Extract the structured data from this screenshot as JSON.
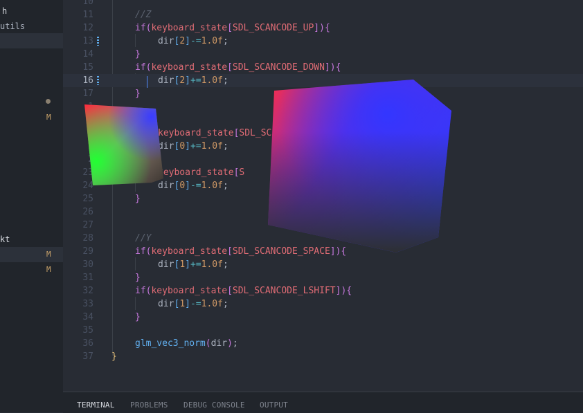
{
  "sidebar": {
    "rows": [
      {
        "text": "h",
        "badge": ""
      },
      {
        "text": "utils",
        "badge": ""
      },
      {
        "text": "kt",
        "badge": ""
      }
    ],
    "badges": [
      "M",
      "M",
      "M"
    ]
  },
  "editor": {
    "lines": [
      {
        "n": "10"
      },
      {
        "n": "11"
      },
      {
        "n": "12"
      },
      {
        "n": "13"
      },
      {
        "n": "14"
      },
      {
        "n": "15"
      },
      {
        "n": "16"
      },
      {
        "n": "17"
      },
      {
        "n": "1"
      },
      {
        "n": "2"
      },
      {
        "n": "2"
      },
      {
        "n": "2"
      },
      {
        "n": "23"
      },
      {
        "n": "24"
      },
      {
        "n": "25"
      },
      {
        "n": "26"
      },
      {
        "n": "27"
      },
      {
        "n": "28"
      },
      {
        "n": "29"
      },
      {
        "n": "30"
      },
      {
        "n": "31"
      },
      {
        "n": "32"
      },
      {
        "n": "33"
      },
      {
        "n": "34"
      },
      {
        "n": "35"
      },
      {
        "n": "36"
      },
      {
        "n": "37"
      }
    ],
    "current_line": "16"
  },
  "code": {
    "c_z": "//Z",
    "c_y": "//Y",
    "kw_if": "if",
    "ks": "keyboard_state",
    "dir": "dir",
    "up": "SDL_SCANCODE_UP",
    "down": "SDL_SCANCODE_DOWN",
    "sc": "SDL_SC",
    "s": "S",
    "space": "SDL_SCANCODE_SPACE",
    "lshift": "SDL_SCANCODE_LSHIFT",
    "one": "1.0f",
    "i0": "0",
    "i1": "1",
    "i2": "2",
    "minus_eq": "-=",
    "plus_eq": "+=",
    "norm": "glm_vec3_norm"
  },
  "panel": {
    "tabs": [
      "TERMINAL",
      "PROBLEMS",
      "DEBUG CONSOLE",
      "OUTPUT"
    ],
    "active": "TERMINAL"
  }
}
